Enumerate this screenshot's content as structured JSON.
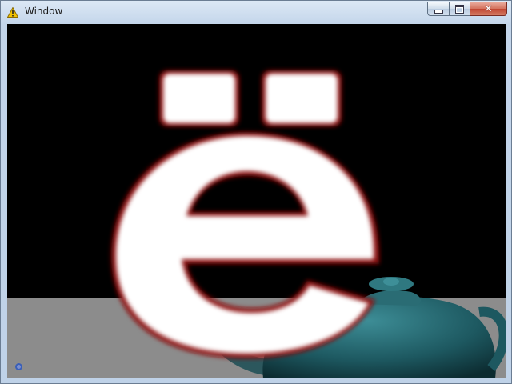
{
  "window": {
    "title": "Window",
    "icon": "warning-icon",
    "buttons": {
      "minimize": "minimize-icon",
      "maximize": "maximize-icon",
      "close": "close-icon"
    }
  },
  "viewport": {
    "rendered_glyph": "ë",
    "background_color": "#000000",
    "floor_color": "#8c8c8c",
    "glyph_color": "#ffffff",
    "glyph_outline_color": "#8b1010",
    "teapot_color": "#1d5860"
  }
}
